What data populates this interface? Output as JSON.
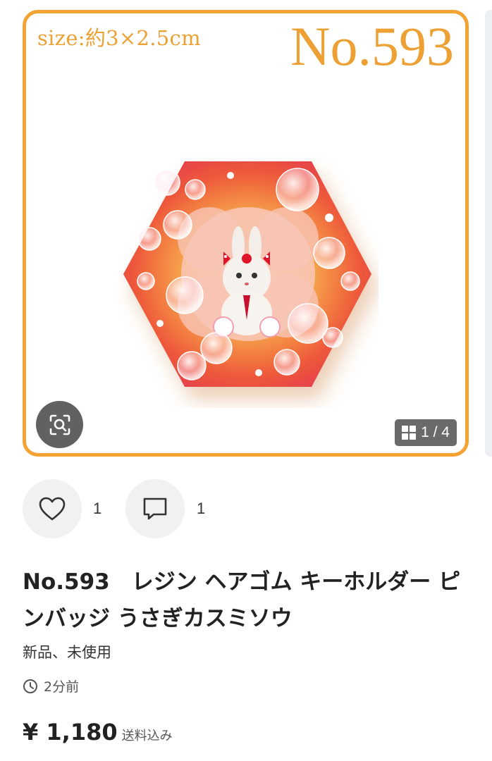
{
  "image": {
    "size_label": "size:約3×2.5cm",
    "number_label": "No.593",
    "page_indicator": "1 / 4",
    "border_color": "#f4a233",
    "lens_icon": "image-search-icon",
    "gallery_icon": "grid-icon"
  },
  "actions": {
    "like_icon": "heart-icon",
    "like_count": "1",
    "comment_icon": "comment-icon",
    "comment_count": "1"
  },
  "product": {
    "title": "No.593　レジン ヘアゴム キーホルダー ピンバッジ うさぎカスミソウ",
    "condition": "新品、未使用",
    "time_icon": "clock-icon",
    "posted": "2分前",
    "price": "¥ 1,180",
    "shipping": "送料込み"
  }
}
